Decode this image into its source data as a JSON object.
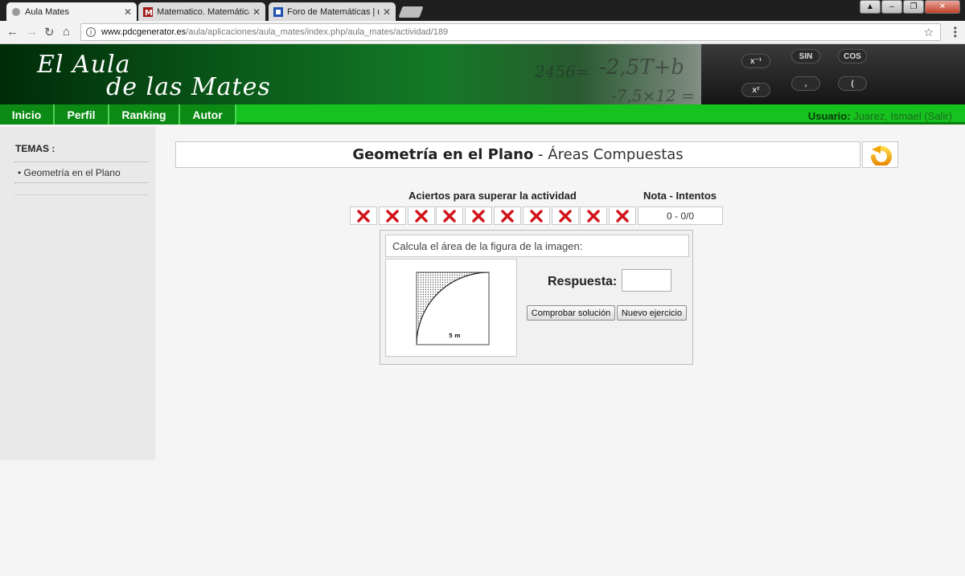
{
  "browser": {
    "tabs": [
      {
        "label": "Aula Mates",
        "active": true
      },
      {
        "label": "Matematico. Matemáticas",
        "active": false
      },
      {
        "label": "Foro de Matemáticas | un",
        "active": false
      }
    ],
    "url_host": "www.pdcgenerator.es",
    "url_path": "/aula/aplicaciones/aula_mates/index.php/aula_mates/actividad/189"
  },
  "site": {
    "logo_line1": "El Aula",
    "logo_line2": "de las Mates",
    "nav": [
      "Inicio",
      "Perfil",
      "Ranking",
      "Autor"
    ],
    "user_label": "Usuario:",
    "user_name": "Juarez, Ismael (Salir)"
  },
  "sidebar": {
    "heading": "TEMAS :",
    "items": [
      "Geometría en el Plano"
    ]
  },
  "activity": {
    "topic": "Geometría en el Plano",
    "separator": " - ",
    "subtopic": "Áreas Compuestas",
    "aciertos_label": "Aciertos para superar la actividad",
    "nota_label": "Nota - Intentos",
    "nota_value": "0 - 0/0",
    "marks": [
      "wrong",
      "wrong",
      "wrong",
      "wrong",
      "wrong",
      "wrong",
      "wrong",
      "wrong",
      "wrong",
      "wrong"
    ],
    "question": "Calcula el área de la figura de la imagen:",
    "figure_label": "5 m",
    "respuesta_label": "Respuesta:",
    "respuesta_value": "",
    "check_button": "Comprobar solución",
    "new_button": "Nuevo ejercicio"
  }
}
